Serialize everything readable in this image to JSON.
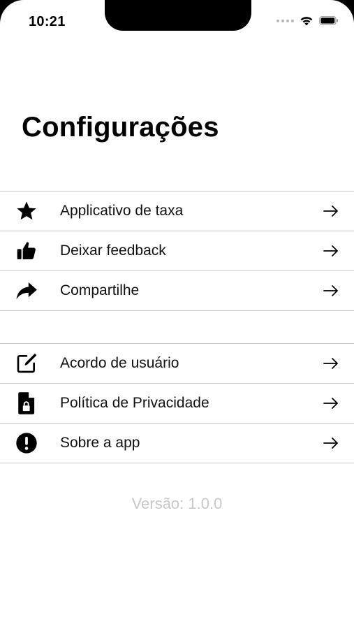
{
  "status_bar": {
    "time": "10:21",
    "icons": [
      "signal-dots-icon",
      "wifi-icon",
      "battery-icon"
    ]
  },
  "page": {
    "title": "Configurações"
  },
  "groups": [
    {
      "items": [
        {
          "label": "Applicativo de taxa",
          "icon": "star-icon"
        },
        {
          "label": "Deixar feedback",
          "icon": "thumbs-up-icon"
        },
        {
          "label": "Compartilhe",
          "icon": "share-arrow-icon"
        }
      ]
    },
    {
      "items": [
        {
          "label": "Acordo de usuário",
          "icon": "edit-icon"
        },
        {
          "label": "Política de Privacidade",
          "icon": "locked-document-icon"
        },
        {
          "label": "Sobre a app",
          "icon": "info-exclamation-icon"
        }
      ]
    }
  ],
  "footer": {
    "version": "Versão: 1.0.0"
  },
  "colors": {
    "background": "#ffffff",
    "text": "#111111",
    "divider": "#c8c8c8",
    "version_text": "#c7c7cc"
  }
}
